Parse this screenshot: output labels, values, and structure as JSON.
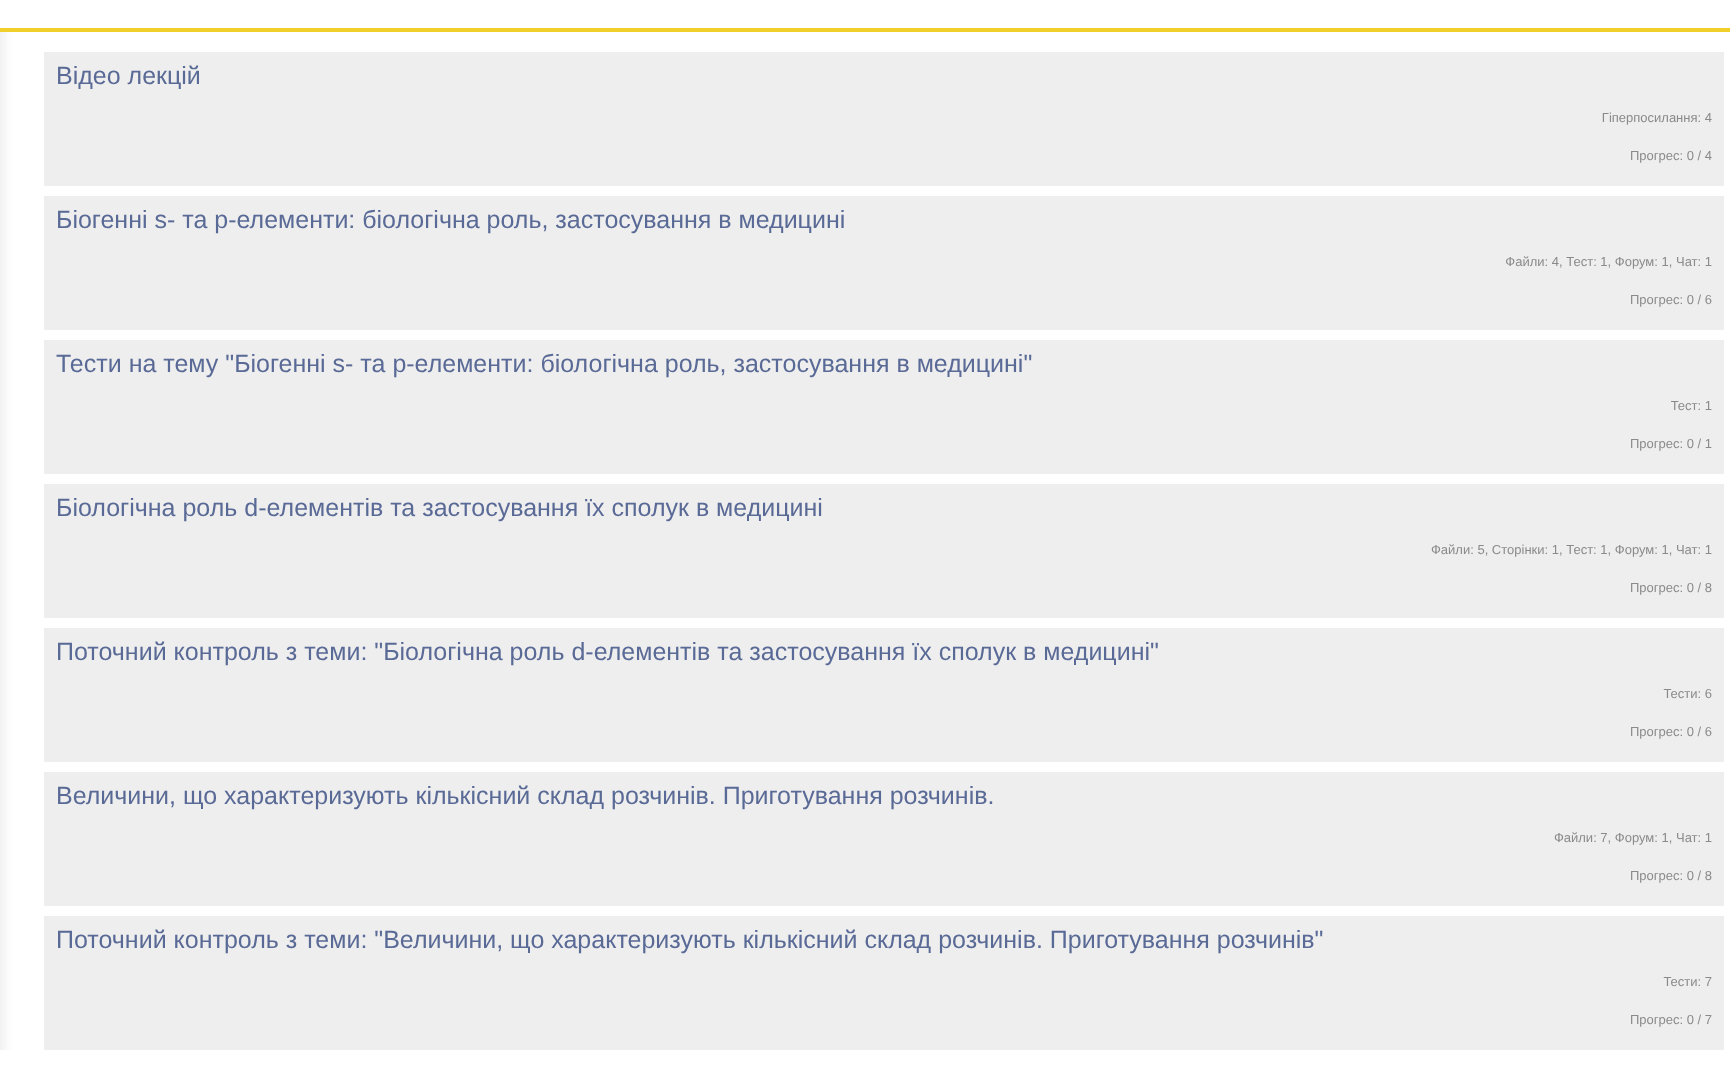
{
  "sections": [
    {
      "title": "Відео лекцій",
      "activities": "Гіперпосилання: 4",
      "progress": "Прогрес: 0 / 4"
    },
    {
      "title": "Біогенні s- та p-елементи: біологічна роль, застосування в медицині",
      "activities": "Файли: 4, Тест: 1, Форум: 1, Чат: 1",
      "progress": "Прогрес: 0 / 6"
    },
    {
      "title": "Тести на тему \"Біогенні s- та p-елементи: біологічна роль, застосування в медицині\"",
      "activities": "Тест: 1",
      "progress": "Прогрес: 0 / 1"
    },
    {
      "title": "Біологічна роль d-елементів та застосування їх сполук в медицині",
      "activities": "Файли: 5, Сторінки: 1, Тест: 1, Форум: 1, Чат: 1",
      "progress": "Прогрес: 0 / 8"
    },
    {
      "title": "Поточний контроль з теми: \"Біологічна роль d-елементів та застосування їх сполук в медицині\"",
      "activities": "Тести: 6",
      "progress": "Прогрес: 0 / 6"
    },
    {
      "title": "Величини, що характеризують кількісний склад розчинів. Приготування розчинів.",
      "activities": "Файли: 7, Форум: 1, Чат: 1",
      "progress": "Прогрес: 0 / 8"
    },
    {
      "title": "Поточний контроль з теми: \"Величини, що характеризують кількісний склад розчинів. Приготування розчинів\"",
      "activities": "Тести: 7",
      "progress": "Прогрес: 0 / 7"
    }
  ]
}
